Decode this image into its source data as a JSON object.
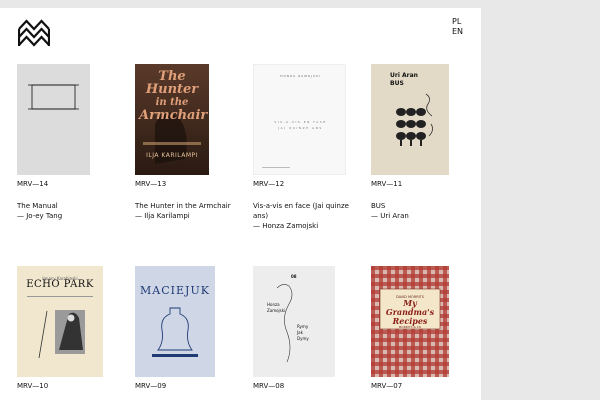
{
  "header": {
    "logo": "mrv-logo",
    "languages": [
      "PL",
      "EN"
    ]
  },
  "books": [
    {
      "code": "MRV—14",
      "title": "The Manual",
      "author": "— Jo-ey Tang"
    },
    {
      "code": "MRV—13",
      "title": "The Hunter in the Armchair",
      "author": "— Ilja Karilampi",
      "cover_text": {
        "line1": "The Hunter",
        "line2": "in the",
        "line3": "Armchair",
        "small": "ILJA KARILAMPI"
      }
    },
    {
      "code": "MRV—12",
      "title": "Vis-a-vis en face (Jai quinze ans)",
      "author": "— Honza Zamojski",
      "cover_text": {
        "top": "HONZA ZAMOJSKI",
        "mid1": "VIS-A-VIS EN FACE",
        "mid2": "JAI QUINZE ANS"
      }
    },
    {
      "code": "MRV—11",
      "title": "BUS",
      "author": "— Uri Aran",
      "cover_text": {
        "author": "Uri Aran",
        "title": "BUS"
      }
    },
    {
      "code": "MRV—10",
      "title": "",
      "author": "",
      "cover_text": {
        "top": "Ignacy Karabinski",
        "title": "ECHO PARK"
      }
    },
    {
      "code": "MRV—09",
      "title": "",
      "author": "",
      "cover_text": {
        "title": "MACIEJUK"
      }
    },
    {
      "code": "MRV—08",
      "title": "",
      "author": "",
      "cover_text": {
        "code": "08",
        "left1": "Honza",
        "left2": "Zamojski",
        "right1": "Rymy",
        "right2": "Jak",
        "right3": "Dymy"
      }
    },
    {
      "code": "MRV—07",
      "title": "",
      "author": "",
      "cover_text": {
        "top": "DAVID MORRITS",
        "title1": "My Grandma's",
        "title2": "Recipes",
        "bottom": "MORRITS & CO"
      }
    }
  ],
  "colors": {
    "cover_manual": "#dcdcdc",
    "cover_hunter": "#4a3226",
    "cover_hunter_text": "#e0a07a",
    "cover_bus": "#e2dac6",
    "cover_echo": "#f1e7cf",
    "cover_maciejuk": "#cfd7e6",
    "cover_maciejuk_ink": "#1f3a75",
    "cover_rymy": "#ededed",
    "cover_recipes_red": "#b13a32"
  }
}
